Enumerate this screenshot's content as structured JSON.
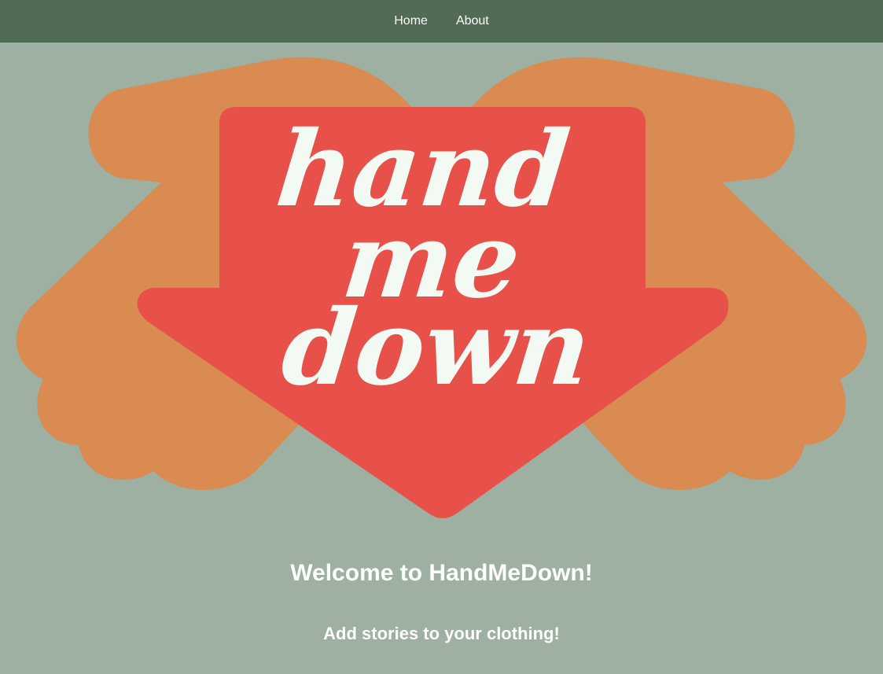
{
  "nav": {
    "links": [
      {
        "label": "Home"
      },
      {
        "label": "About"
      }
    ]
  },
  "logo": {
    "lines": [
      "hand",
      "me",
      "down"
    ],
    "colors": {
      "hands": "#d98b52",
      "arrow": "#e8504a",
      "text": "#f3faf3"
    }
  },
  "hero": {
    "title": "Welcome to HandMeDown!",
    "subtitle": "Add stories to your clothing!"
  },
  "colors": {
    "background": "#9db0a1",
    "navbar": "#526b55"
  }
}
